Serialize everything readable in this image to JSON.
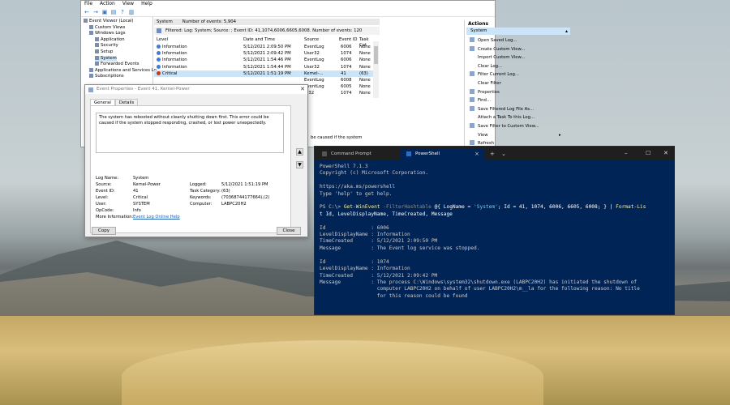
{
  "event_viewer": {
    "menu": [
      "File",
      "Action",
      "View",
      "Help"
    ],
    "tree": [
      {
        "label": "Event Viewer (Local)",
        "indent": 0,
        "selected": false
      },
      {
        "label": "Custom Views",
        "indent": 1,
        "selected": false
      },
      {
        "label": "Windows Logs",
        "indent": 1,
        "selected": false
      },
      {
        "label": "Application",
        "indent": 2,
        "selected": false
      },
      {
        "label": "Security",
        "indent": 2,
        "selected": false
      },
      {
        "label": "Setup",
        "indent": 2,
        "selected": false
      },
      {
        "label": "System",
        "indent": 2,
        "selected": true
      },
      {
        "label": "Forwarded Events",
        "indent": 2,
        "selected": false
      },
      {
        "label": "Applications and Services Lo",
        "indent": 1,
        "selected": false
      },
      {
        "label": "Subscriptions",
        "indent": 1,
        "selected": false
      }
    ],
    "log_name": "System",
    "event_count": "Number of events: 5,904",
    "filter_text": "Filtered: Log: System; Source: ; Event ID: 41,1074,6006,6605,6008. Number of events: 120",
    "columns": [
      "Level",
      "Date and Time",
      "Source",
      "Event ID",
      "Task Cat"
    ],
    "rows": [
      {
        "level": "Information",
        "date": "5/12/2021 2:09:50 PM",
        "source": "EventLog",
        "id": "6006",
        "task": "None",
        "critical": false,
        "selected": false
      },
      {
        "level": "Information",
        "date": "5/12/2021 2:09:42 PM",
        "source": "User32",
        "id": "1074",
        "task": "None",
        "critical": false,
        "selected": false
      },
      {
        "level": "Information",
        "date": "5/12/2021 1:54:46 PM",
        "source": "EventLog",
        "id": "6006",
        "task": "None",
        "critical": false,
        "selected": false
      },
      {
        "level": "Information",
        "date": "5/12/2021 1:54:44 PM",
        "source": "User32",
        "id": "1074",
        "task": "None",
        "critical": false,
        "selected": false
      },
      {
        "level": "Critical",
        "date": "5/12/2021 1:51:19 PM",
        "source": "Kernel-...",
        "id": "41",
        "task": "(63)",
        "critical": true,
        "selected": true
      },
      {
        "level": "",
        "date": "",
        "source": "EventLog",
        "id": "6008",
        "task": "None",
        "critical": false,
        "selected": false
      },
      {
        "level": "",
        "date": "",
        "source": "EventLog",
        "id": "6005",
        "task": "None",
        "critical": false,
        "selected": false
      },
      {
        "level": "",
        "date": "",
        "source": "er32",
        "id": "1074",
        "task": "None",
        "critical": false,
        "selected": false
      }
    ],
    "detail_partial": "be caused if the system",
    "actions_header": "Actions",
    "actions_sub": "System",
    "actions": [
      {
        "label": "Open Saved Log...",
        "icon": true,
        "submenu": false
      },
      {
        "label": "Create Custom View...",
        "icon": true,
        "submenu": false
      },
      {
        "label": "Import Custom View...",
        "icon": false,
        "submenu": false
      },
      {
        "label": "Clear Log...",
        "icon": false,
        "submenu": false
      },
      {
        "label": "Filter Current Log...",
        "icon": true,
        "submenu": false
      },
      {
        "label": "Clear Filter",
        "icon": false,
        "submenu": false
      },
      {
        "label": "Properties",
        "icon": true,
        "submenu": false
      },
      {
        "label": "Find...",
        "icon": true,
        "submenu": false
      },
      {
        "label": "Save Filtered Log File As...",
        "icon": true,
        "submenu": false
      },
      {
        "label": "Attach a Task To this Log...",
        "icon": false,
        "submenu": false
      },
      {
        "label": "Save Filter to Custom View...",
        "icon": true,
        "submenu": false
      },
      {
        "label": "View",
        "icon": false,
        "submenu": true
      },
      {
        "label": "Refresh",
        "icon": true,
        "submenu": false
      }
    ]
  },
  "properties": {
    "title": "Event Properties - Event 41, Kernel-Power",
    "tabs": [
      "General",
      "Details"
    ],
    "message": "The system has rebooted without cleanly shutting down first. This error could be caused if the system stopped responding, crashed, or lost power unexpectedly.",
    "log_name_label": "Log Name:",
    "log_name": "System",
    "source_label": "Source:",
    "source": "Kernel-Power",
    "logged_label": "Logged:",
    "logged": "5/12/2021 1:51:19 PM",
    "event_id_label": "Event ID:",
    "event_id": "41",
    "task_label": "Task Category:",
    "task": "(63)",
    "level_label": "Level:",
    "level": "Critical",
    "keywords_label": "Keywords:",
    "keywords": "(70368744177664),(2)",
    "user_label": "User:",
    "user": "SYSTEM",
    "computer_label": "Computer:",
    "computer": "LABPC20H2",
    "opcode_label": "OpCode:",
    "opcode": "Info",
    "more_label": "More Information:",
    "more_link": "Event Log Online Help",
    "copy": "Copy",
    "close": "Close"
  },
  "terminal": {
    "tabs": [
      {
        "label": "Command Prompt",
        "active": false
      },
      {
        "label": "PowerShell",
        "active": true
      }
    ],
    "close_tab": "×",
    "new_tab": "+",
    "dropdown": "⌄",
    "win_min": "–",
    "win_max": "☐",
    "win_close": "✕",
    "lines": {
      "l1": "PowerShell 7.1.3",
      "l2": "Copyright (c) Microsoft Corporation.",
      "l3": "https://aka.ms/powershell",
      "l4": "Type 'help' to get help.",
      "prompt": "PS C:\\> ",
      "cmd1": "Get-WinEvent",
      "cmd2": " -FilterHashtable ",
      "cmd3": "@{ LogName = ",
      "cmd4": "'System'",
      "cmd5": "; Id = 41, 1074, 6006, 6605, 6008; } | ",
      "cmd6": "Format-Lis",
      "cmd7": "t Id, LevelDisplayName, TimeCreated, Message",
      "r1": "Id               : 6006",
      "r2": "LevelDisplayName : Information",
      "r3": "TimeCreated      : 5/12/2021 2:09:50 PM",
      "r4": "Message          : The Event log service was stopped.",
      "r5": "Id               : 1074",
      "r6": "LevelDisplayName : Information",
      "r7": "TimeCreated      : 5/12/2021 2:09:42 PM",
      "r8": "Message          : The process C:\\Windows\\system32\\shutdown.exe (LABPC20H2) has initiated the shutdown of",
      "r9": "                   computer LABPC20H2 on behalf of user LABPC20H2\\m__la for the following reason: No title",
      "r10": "                   for this reason could be found"
    }
  }
}
